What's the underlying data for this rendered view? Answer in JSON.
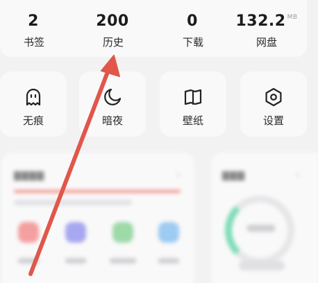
{
  "stats": [
    {
      "id": "bookmarks",
      "value": "2",
      "unit": "",
      "label": "书签"
    },
    {
      "id": "history",
      "value": "200",
      "unit": "",
      "label": "历史"
    },
    {
      "id": "downloads",
      "value": "0",
      "unit": "",
      "label": "下载"
    },
    {
      "id": "drive",
      "value": "132.2",
      "unit": "MB",
      "label": "网盘"
    }
  ],
  "tiles": [
    {
      "id": "incognito",
      "icon": "ghost-icon",
      "label": "无痕"
    },
    {
      "id": "night",
      "icon": "moon-icon",
      "label": "暗夜"
    },
    {
      "id": "wallpaper",
      "icon": "book-icon",
      "label": "壁纸"
    },
    {
      "id": "settings",
      "icon": "hexagon-gear-icon",
      "label": "设置"
    }
  ],
  "colors": {
    "arrow": "#e0574a",
    "card": "#f9f9fa",
    "background": "#f2f2f3",
    "text": "#1c1c1e"
  }
}
